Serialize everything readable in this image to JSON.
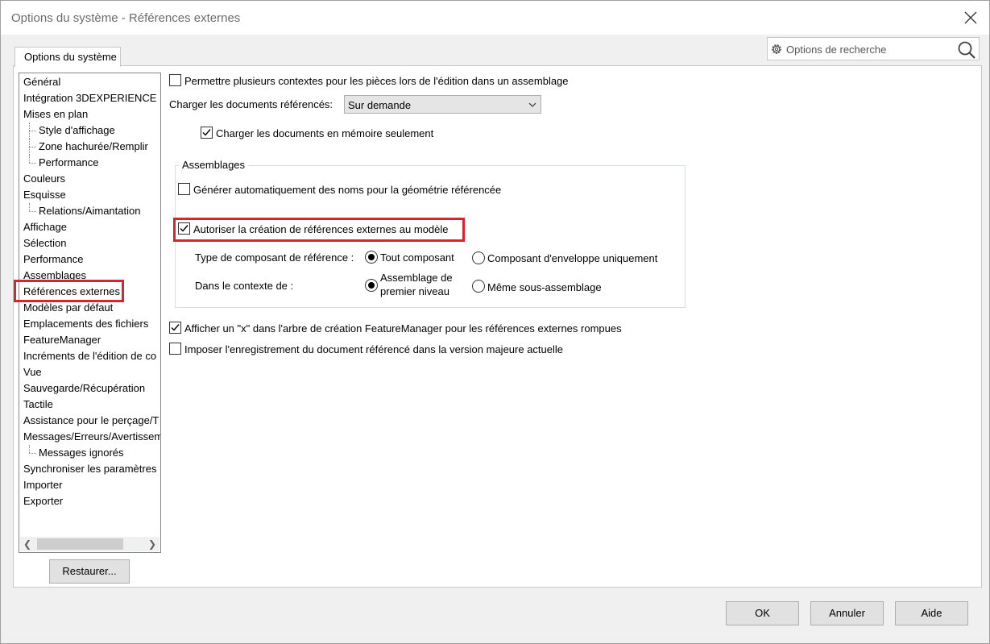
{
  "window": {
    "title": "Options du système - Références externes"
  },
  "search": {
    "placeholder": "Options de recherche"
  },
  "tab": {
    "label": "Options du système"
  },
  "tree": {
    "items": [
      {
        "label": "Général",
        "level": 0
      },
      {
        "label": "Intégration 3DEXPERIENCE",
        "level": 0
      },
      {
        "label": "Mises en plan",
        "level": 0
      },
      {
        "label": "Style d'affichage",
        "level": 1
      },
      {
        "label": "Zone hachurée/Remplir",
        "level": 1
      },
      {
        "label": "Performance",
        "level": 1
      },
      {
        "label": "Couleurs",
        "level": 0
      },
      {
        "label": "Esquisse",
        "level": 0
      },
      {
        "label": "Relations/Aimantation",
        "level": 1
      },
      {
        "label": "Affichage",
        "level": 0
      },
      {
        "label": "Sélection",
        "level": 0
      },
      {
        "label": "Performance",
        "level": 0
      },
      {
        "label": "Assemblages",
        "level": 0
      },
      {
        "label": "Références externes",
        "level": 0,
        "selected": true
      },
      {
        "label": "Modèles par défaut",
        "level": 0
      },
      {
        "label": "Emplacements des fichiers",
        "level": 0
      },
      {
        "label": "FeatureManager",
        "level": 0
      },
      {
        "label": "Incréments de l'édition de co",
        "level": 0
      },
      {
        "label": "Vue",
        "level": 0
      },
      {
        "label": "Sauvegarde/Récupération",
        "level": 0
      },
      {
        "label": "Tactile",
        "level": 0
      },
      {
        "label": "Assistance pour le perçage/T",
        "level": 0
      },
      {
        "label": "Messages/Erreurs/Avertissem",
        "level": 0
      },
      {
        "label": "Messages ignorés",
        "level": 1
      },
      {
        "label": "Synchroniser les paramètres",
        "level": 0
      },
      {
        "label": "Importer",
        "level": 0
      },
      {
        "label": "Exporter",
        "level": 0
      }
    ]
  },
  "buttons": {
    "restore": "Restaurer...",
    "ok": "OK",
    "cancel": "Annuler",
    "help": "Aide"
  },
  "options": {
    "multi_context": {
      "label": "Permettre plusieurs contextes pour les pièces lors de l'édition dans un assemblage",
      "checked": false
    },
    "load_docs_label": "Charger les documents référencés:",
    "load_docs_value": "Sur demande",
    "load_memory": {
      "label": "Charger les documents en mémoire seulement",
      "checked": true
    },
    "assemblies_group": "Assemblages",
    "auto_names": {
      "label": "Générer automatiquement des noms pour la géométrie référencée",
      "checked": false
    },
    "allow_ext_refs": {
      "label": "Autoriser la création de références externes au modèle",
      "checked": true
    },
    "ref_component_type_label": "Type de composant de référence :",
    "ref_all_component": {
      "label": "Tout composant",
      "selected": true
    },
    "ref_envelope_only": {
      "label": "Composant d'enveloppe uniquement",
      "selected": false
    },
    "context_label": "Dans le contexte de :",
    "context_top_line1": "Assemblage de",
    "context_top_line2": "premier niveau",
    "context_same_sub": {
      "label": "Même sous-assemblage",
      "selected": false
    },
    "show_x": {
      "label": "Afficher un \"x\" dans l'arbre de création FeatureManager pour les références externes rompues",
      "checked": true
    },
    "force_save": {
      "label": "Imposer l'enregistrement du document référencé dans la version majeure actuelle",
      "checked": false
    }
  }
}
